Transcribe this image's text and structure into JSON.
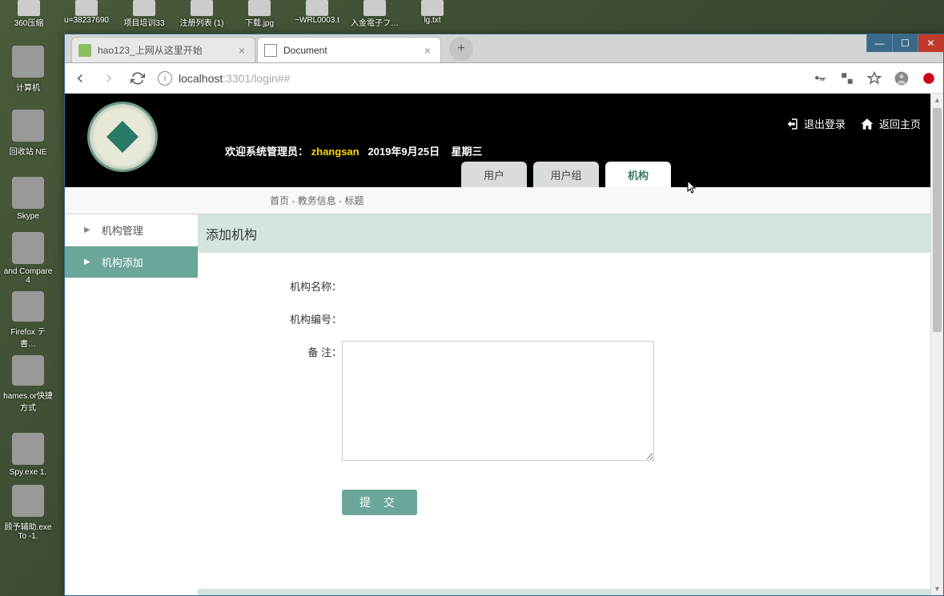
{
  "desktop_top_icons": [
    "360压缩",
    "u=38237690",
    "项目培训33",
    "注册列表 (1)",
    "下载.jpg",
    "~WRL0003.t",
    "入金電子フ…",
    "lg.txt"
  ],
  "desktop_left_icons": [
    "计算机",
    "回收站  NE",
    "Skype",
    "and Compare 4",
    "Firefox テ書…",
    "hames.or快捷方式",
    "Spy.exe  1.",
    "顾予辅助.exe  To -1."
  ],
  "win": {
    "min": "—",
    "max": "☐",
    "close": "✕"
  },
  "tabs": [
    {
      "title": "hao123_上网从这里开始",
      "active": false
    },
    {
      "title": "Document",
      "active": true
    }
  ],
  "url": {
    "host": "localhost",
    "path": ":3301/login##"
  },
  "header": {
    "welcome_prefix": "欢迎系统管理员：",
    "username": "zhangsan",
    "date": "2019年9月25日",
    "weekday": "星期三",
    "logout": "退出登录",
    "home": "返回主页"
  },
  "top_tabs": [
    {
      "label": "用户",
      "active": false
    },
    {
      "label": "用户组",
      "active": false
    },
    {
      "label": "机构",
      "active": true
    }
  ],
  "breadcrumb": {
    "p1": "首页",
    "p2": "教务信息",
    "p3": "标题",
    "sep": " - "
  },
  "sidebar": [
    {
      "label": "机构管理",
      "active": false
    },
    {
      "label": "机构添加",
      "active": true
    }
  ],
  "main": {
    "title": "添加机构",
    "fields": {
      "name_label": "机构名称：",
      "code_label": "机构编号：",
      "remark_label": "备  注："
    },
    "submit": "提 交"
  }
}
